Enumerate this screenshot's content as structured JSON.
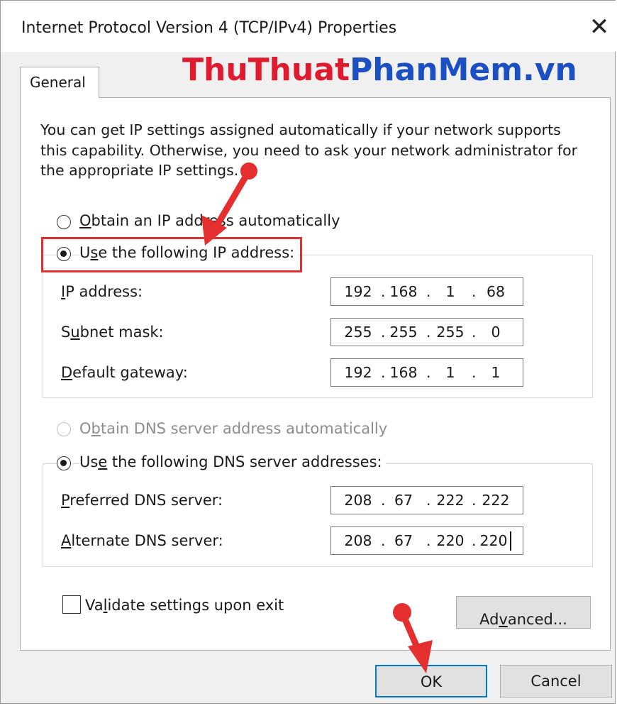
{
  "window": {
    "title": "Internet Protocol Version 4 (TCP/IPv4) Properties",
    "close_icon": "close-icon"
  },
  "watermark": {
    "part1": "ThuThuat",
    "part2": "PhanMem.vn",
    "colors": {
      "part1": "#e01b2f",
      "part2": "#1c4fc4"
    }
  },
  "tabs": [
    {
      "label": "General",
      "selected": true
    }
  ],
  "intro_text": "You can get IP settings assigned automatically if your network supports this capability. Otherwise, you need to ask your network administrator for the appropriate IP settings.",
  "ip_section": {
    "auto_option": {
      "pre": "",
      "accel": "O",
      "post": "btain an IP address automatically",
      "selected": false
    },
    "manual_option": {
      "pre": "U",
      "accel": "s",
      "post": "e the following IP address:",
      "selected": true
    },
    "fields": [
      {
        "pre": "",
        "accel": "I",
        "post": "P address:",
        "octets": [
          "192",
          "168",
          "1",
          "68"
        ]
      },
      {
        "pre": "S",
        "accel": "u",
        "post": "bnet mask:",
        "octets": [
          "255",
          "255",
          "255",
          "0"
        ]
      },
      {
        "pre": "",
        "accel": "D",
        "post": "efault gateway:",
        "octets": [
          "192",
          "168",
          "1",
          "1"
        ]
      }
    ]
  },
  "dns_section": {
    "auto_option": {
      "pre": "O",
      "accel": "b",
      "post": "tain DNS server address automatically",
      "selected": false,
      "disabled": true
    },
    "manual_option": {
      "pre": "Us",
      "accel": "e",
      "post": " the following DNS server addresses:",
      "selected": true
    },
    "fields": [
      {
        "pre": "",
        "accel": "P",
        "post": "referred DNS server:",
        "octets": [
          "208",
          "67",
          "222",
          "222"
        ]
      },
      {
        "pre": "",
        "accel": "A",
        "post": "lternate DNS server:",
        "octets": [
          "208",
          "67",
          "220",
          "220"
        ]
      }
    ]
  },
  "validate": {
    "pre": "Va",
    "accel": "l",
    "post": "idate settings upon exit",
    "checked": false
  },
  "buttons": {
    "advanced": {
      "pre": "Ad",
      "accel": "v",
      "post": "anced..."
    },
    "ok": "OK",
    "cancel": "Cancel"
  },
  "annotation": {
    "color": "#e52e2e"
  }
}
